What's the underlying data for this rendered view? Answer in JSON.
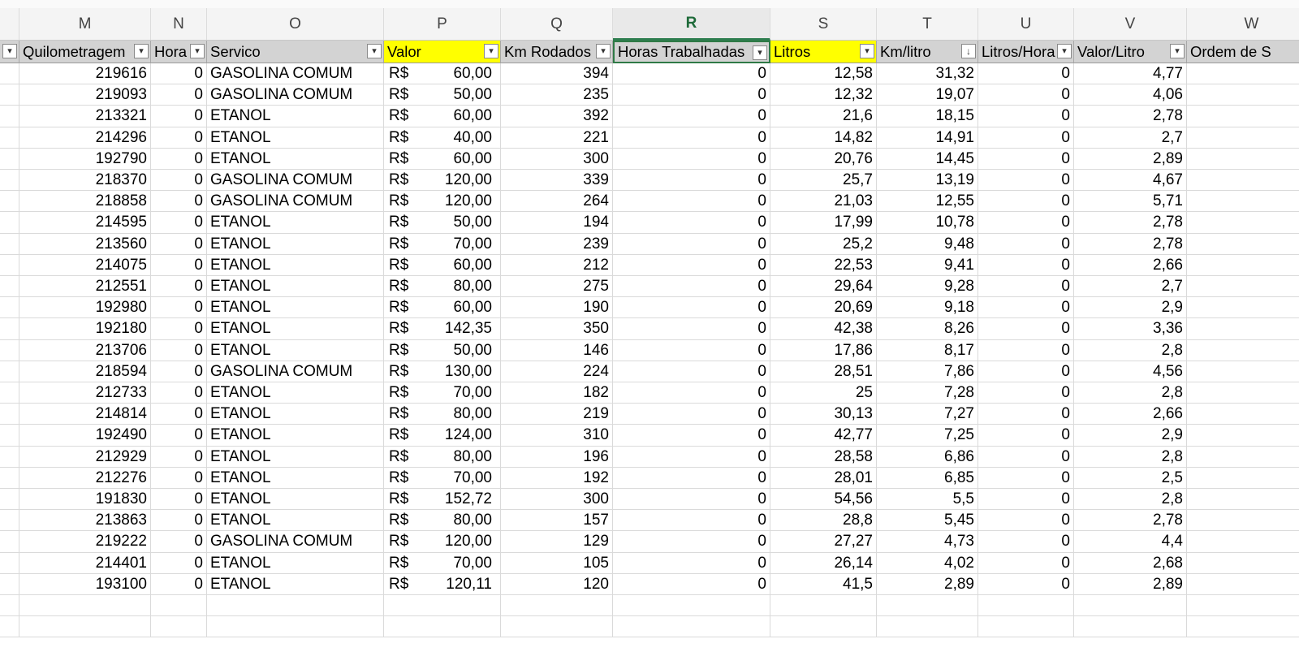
{
  "column_letters": [
    "M",
    "N",
    "O",
    "P",
    "Q",
    "R",
    "S",
    "T",
    "U",
    "V",
    "W"
  ],
  "selected_column": "R",
  "headers": [
    {
      "label": "Quilometragem",
      "filter": "dropdown",
      "highlight": false
    },
    {
      "label": "Hora",
      "filter": "dropdown",
      "highlight": false
    },
    {
      "label": "Servico",
      "filter": "dropdown",
      "highlight": false
    },
    {
      "label": "Valor",
      "filter": "dropdown",
      "highlight": true
    },
    {
      "label": "Km Rodados",
      "filter": "dropdown",
      "highlight": false
    },
    {
      "label": "Horas Trabalhadas",
      "filter": "dropdown",
      "highlight": false,
      "active": true
    },
    {
      "label": "Litros",
      "filter": "dropdown",
      "highlight": true
    },
    {
      "label": "Km/litro",
      "filter": "sort-descending",
      "highlight": false
    },
    {
      "label": "Litros/Hora",
      "filter": "dropdown",
      "highlight": false
    },
    {
      "label": "Valor/Litro",
      "filter": "dropdown",
      "highlight": false
    },
    {
      "label": "Ordem de S",
      "filter": "none",
      "highlight": false
    }
  ],
  "currency_symbol": "R$",
  "rows": [
    {
      "km": "219616",
      "hora": "0",
      "servico": "GASOLINA COMUM",
      "valor": "60,00",
      "km_rodados": "394",
      "horas": "0",
      "litros": "12,58",
      "km_litro": "31,32",
      "litros_hora": "0",
      "valor_litro": "4,77"
    },
    {
      "km": "219093",
      "hora": "0",
      "servico": "GASOLINA COMUM",
      "valor": "50,00",
      "km_rodados": "235",
      "horas": "0",
      "litros": "12,32",
      "km_litro": "19,07",
      "litros_hora": "0",
      "valor_litro": "4,06"
    },
    {
      "km": "213321",
      "hora": "0",
      "servico": "ETANOL",
      "valor": "60,00",
      "km_rodados": "392",
      "horas": "0",
      "litros": "21,6",
      "km_litro": "18,15",
      "litros_hora": "0",
      "valor_litro": "2,78"
    },
    {
      "km": "214296",
      "hora": "0",
      "servico": "ETANOL",
      "valor": "40,00",
      "km_rodados": "221",
      "horas": "0",
      "litros": "14,82",
      "km_litro": "14,91",
      "litros_hora": "0",
      "valor_litro": "2,7"
    },
    {
      "km": "192790",
      "hora": "0",
      "servico": "ETANOL",
      "valor": "60,00",
      "km_rodados": "300",
      "horas": "0",
      "litros": "20,76",
      "km_litro": "14,45",
      "litros_hora": "0",
      "valor_litro": "2,89"
    },
    {
      "km": "218370",
      "hora": "0",
      "servico": "GASOLINA COMUM",
      "valor": "120,00",
      "km_rodados": "339",
      "horas": "0",
      "litros": "25,7",
      "km_litro": "13,19",
      "litros_hora": "0",
      "valor_litro": "4,67"
    },
    {
      "km": "218858",
      "hora": "0",
      "servico": "GASOLINA COMUM",
      "valor": "120,00",
      "km_rodados": "264",
      "horas": "0",
      "litros": "21,03",
      "km_litro": "12,55",
      "litros_hora": "0",
      "valor_litro": "5,71"
    },
    {
      "km": "214595",
      "hora": "0",
      "servico": "ETANOL",
      "valor": "50,00",
      "km_rodados": "194",
      "horas": "0",
      "litros": "17,99",
      "km_litro": "10,78",
      "litros_hora": "0",
      "valor_litro": "2,78"
    },
    {
      "km": "213560",
      "hora": "0",
      "servico": "ETANOL",
      "valor": "70,00",
      "km_rodados": "239",
      "horas": "0",
      "litros": "25,2",
      "km_litro": "9,48",
      "litros_hora": "0",
      "valor_litro": "2,78"
    },
    {
      "km": "214075",
      "hora": "0",
      "servico": "ETANOL",
      "valor": "60,00",
      "km_rodados": "212",
      "horas": "0",
      "litros": "22,53",
      "km_litro": "9,41",
      "litros_hora": "0",
      "valor_litro": "2,66"
    },
    {
      "km": "212551",
      "hora": "0",
      "servico": "ETANOL",
      "valor": "80,00",
      "km_rodados": "275",
      "horas": "0",
      "litros": "29,64",
      "km_litro": "9,28",
      "litros_hora": "0",
      "valor_litro": "2,7"
    },
    {
      "km": "192980",
      "hora": "0",
      "servico": "ETANOL",
      "valor": "60,00",
      "km_rodados": "190",
      "horas": "0",
      "litros": "20,69",
      "km_litro": "9,18",
      "litros_hora": "0",
      "valor_litro": "2,9"
    },
    {
      "km": "192180",
      "hora": "0",
      "servico": "ETANOL",
      "valor": "142,35",
      "km_rodados": "350",
      "horas": "0",
      "litros": "42,38",
      "km_litro": "8,26",
      "litros_hora": "0",
      "valor_litro": "3,36"
    },
    {
      "km": "213706",
      "hora": "0",
      "servico": "ETANOL",
      "valor": "50,00",
      "km_rodados": "146",
      "horas": "0",
      "litros": "17,86",
      "km_litro": "8,17",
      "litros_hora": "0",
      "valor_litro": "2,8"
    },
    {
      "km": "218594",
      "hora": "0",
      "servico": "GASOLINA COMUM",
      "valor": "130,00",
      "km_rodados": "224",
      "horas": "0",
      "litros": "28,51",
      "km_litro": "7,86",
      "litros_hora": "0",
      "valor_litro": "4,56"
    },
    {
      "km": "212733",
      "hora": "0",
      "servico": "ETANOL",
      "valor": "70,00",
      "km_rodados": "182",
      "horas": "0",
      "litros": "25",
      "km_litro": "7,28",
      "litros_hora": "0",
      "valor_litro": "2,8"
    },
    {
      "km": "214814",
      "hora": "0",
      "servico": "ETANOL",
      "valor": "80,00",
      "km_rodados": "219",
      "horas": "0",
      "litros": "30,13",
      "km_litro": "7,27",
      "litros_hora": "0",
      "valor_litro": "2,66"
    },
    {
      "km": "192490",
      "hora": "0",
      "servico": "ETANOL",
      "valor": "124,00",
      "km_rodados": "310",
      "horas": "0",
      "litros": "42,77",
      "km_litro": "7,25",
      "litros_hora": "0",
      "valor_litro": "2,9"
    },
    {
      "km": "212929",
      "hora": "0",
      "servico": "ETANOL",
      "valor": "80,00",
      "km_rodados": "196",
      "horas": "0",
      "litros": "28,58",
      "km_litro": "6,86",
      "litros_hora": "0",
      "valor_litro": "2,8"
    },
    {
      "km": "212276",
      "hora": "0",
      "servico": "ETANOL",
      "valor": "70,00",
      "km_rodados": "192",
      "horas": "0",
      "litros": "28,01",
      "km_litro": "6,85",
      "litros_hora": "0",
      "valor_litro": "2,5"
    },
    {
      "km": "191830",
      "hora": "0",
      "servico": "ETANOL",
      "valor": "152,72",
      "km_rodados": "300",
      "horas": "0",
      "litros": "54,56",
      "km_litro": "5,5",
      "litros_hora": "0",
      "valor_litro": "2,8"
    },
    {
      "km": "213863",
      "hora": "0",
      "servico": "ETANOL",
      "valor": "80,00",
      "km_rodados": "157",
      "horas": "0",
      "litros": "28,8",
      "km_litro": "5,45",
      "litros_hora": "0",
      "valor_litro": "2,78"
    },
    {
      "km": "219222",
      "hora": "0",
      "servico": "GASOLINA COMUM",
      "valor": "120,00",
      "km_rodados": "129",
      "horas": "0",
      "litros": "27,27",
      "km_litro": "4,73",
      "litros_hora": "0",
      "valor_litro": "4,4"
    },
    {
      "km": "214401",
      "hora": "0",
      "servico": "ETANOL",
      "valor": "70,00",
      "km_rodados": "105",
      "horas": "0",
      "litros": "26,14",
      "km_litro": "4,02",
      "litros_hora": "0",
      "valor_litro": "2,68"
    },
    {
      "km": "193100",
      "hora": "0",
      "servico": "ETANOL",
      "valor": "120,11",
      "km_rodados": "120",
      "horas": "0",
      "litros": "41,5",
      "km_litro": "2,89",
      "litros_hora": "0",
      "valor_litro": "2,89"
    }
  ],
  "colors": {
    "header_gray": "#d3d3d3",
    "highlight_yellow": "#ffff00",
    "selection_green": "#2e7d4f",
    "gridline": "#dadada"
  }
}
